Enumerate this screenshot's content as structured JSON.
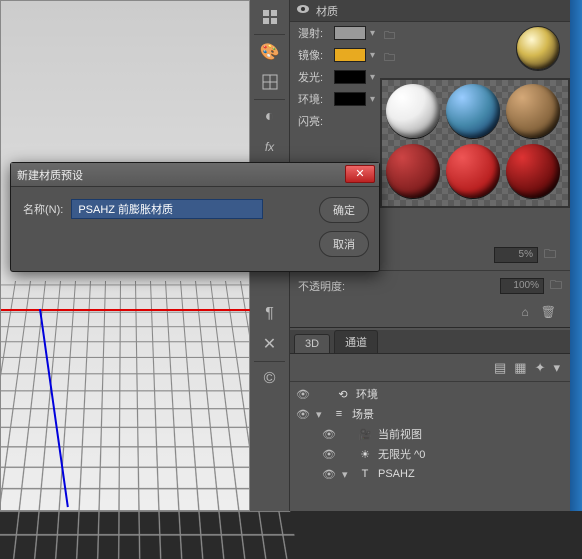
{
  "dialog": {
    "title": "新建材质预设",
    "name_label": "名称(N):",
    "name_value": "PSAHZ 前膨胀材质",
    "ok": "确定",
    "cancel": "取消"
  },
  "panels": {
    "materials_header": "材质",
    "diffuse": "漫射:",
    "specular": "镜像:",
    "glow": "发光:",
    "ambient": "环境:",
    "shine": "闪亮:",
    "pct_5": "5%",
    "opacity_label": "不透明度:",
    "pct_100": "100%"
  },
  "tabs": {
    "tab_3d": "3D",
    "tab_channels": "通道"
  },
  "tree": {
    "environment": "环境",
    "scene": "场景",
    "current_view": "当前视图",
    "infinite_light": "无限光 ^0",
    "psahz": "PSAHZ"
  },
  "swatches": {
    "diffuse": "#9a9a9a",
    "specular": "#e8aa20",
    "glow": "#000000",
    "ambient": "#000000"
  }
}
